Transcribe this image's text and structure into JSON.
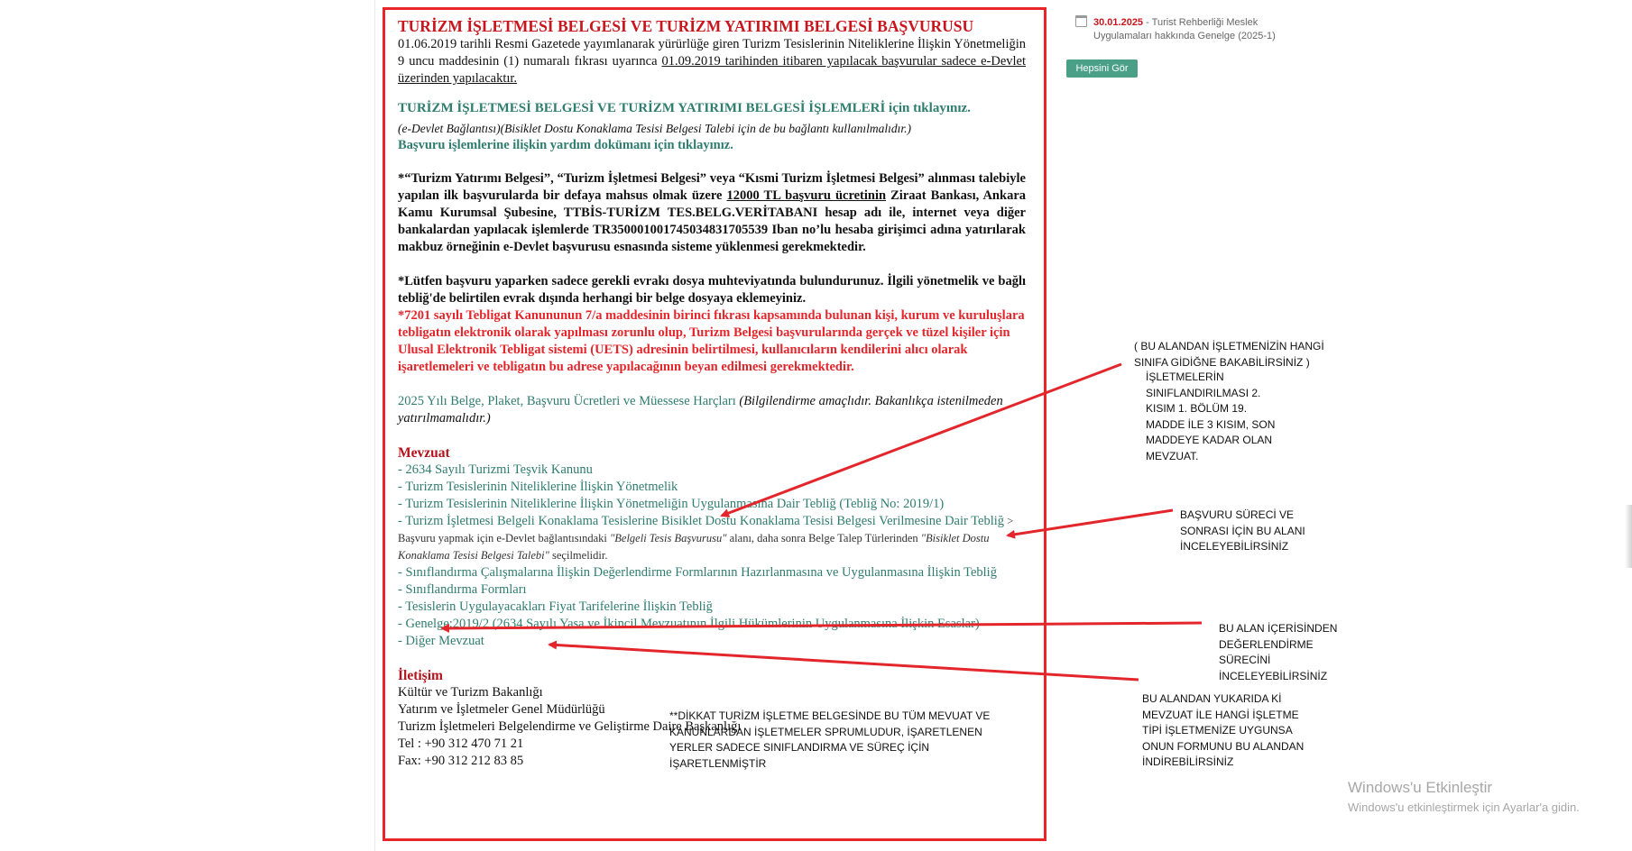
{
  "main": {
    "title": "TURİZM İŞLETMESİ BELGESİ VE TURİZM YATIRIMI BELGESİ BAŞVURUSU",
    "intro_a": "01.06.2019 tarihli Resmi Gazetede yayımlanarak yürürlüğe giren Turizm Tesislerinin Niteliklerine İlişkin Yönetmeliğin 9 uncu maddesinin (1) numaralı fıkrası uyarınca ",
    "intro_b": "01.09.2019 tarihinden itibaren yapılacak başvurular sadece e-Devlet üzerinden yapılacaktır.",
    "link_ops_text": "TURİZM İŞLETMESİ BELGESİ VE TURİZM YATIRIMI BELGESİ İŞLEMLERİ için tıklayınız.",
    "edevlet_note": "(e-Devlet Bağlantısı)(Bisiklet Dostu Konaklama Tesisi Belgesi Talebi için de bu bağlantı kullanılmalıdır.)",
    "help_link": "Başvuru işlemlerine ilişkin yardım dokümanı için tıklayınız.",
    "fee_a": "*“Turizm Yatırımı Belgesi”, “Turizm İşletmesi Belgesi” veya “Kısmi Turizm İşletmesi Belgesi” alınması talebiyle yapılan ilk başvurularda bir defaya mahsus olmak üzere ",
    "fee_b": "12000 TL başvuru ücretinin",
    "fee_c": " Ziraat Bankası, Ankara Kamu Kurumsal Şubesine, TTBİS-TURİZM TES.BELG.VERİTABANI hesap adı ile, internet veya diğer bankalardan yapılacak işlemlerde TR350001001745034831705539 Iban no’lu hesaba girişimci adına yatırılarak makbuz örneğinin e-Devlet başvurusu esnasında sisteme yüklenmesi gerekmektedir.",
    "docs_note": "*Lütfen başvuru yaparken sadece gerekli evrakı dosya muhteviyatında bulundurunuz. İlgili yönetmelik ve bağlı tebliğ'de belirtilen evrak dışında herhangi bir belge dosyaya eklemeyiniz.",
    "tebligat_note": "*7201 sayılı Tebligat Kanununun 7/a maddesinin birinci fıkrası kapsamında bulunan kişi, kurum ve kuruluşlara tebligatın elektronik olarak yapılması zorunlu olup, Turizm Belgesi başvurularında gerçek ve tüzel kişiler için Ulusal Elektronik Tebligat sistemi (UETS) adresinin belirtilmesi, kullanıcıların kendilerini alıcı olarak işaretlemeleri ve tebligatın bu adrese yapılacağının beyan edilmesi gerekmektedir.",
    "fees_link": "2025 Yılı Belge, Plaket, Başvuru Ücretleri ve Müessese Harçları",
    "fees_note": " (Bilgilendirme amaçlıdır. Bakanlıkça istenilmeden yatırılmamalıdır.)",
    "mevzuat_heading": "Mevzuat",
    "mevzuat": [
      "- 2634 Sayılı Turizmi Teşvik Kanunu",
      "- Turizm Tesislerinin Niteliklerine İlişkin Yönetmelik",
      "- Turizm Tesislerinin Niteliklerine İlişkin Yönetmeliğin Uygulanmasına Dair Tebliğ (Tebliğ No: 2019/1)",
      "- Turizm İşletmesi Belgeli Konaklama Tesislerine Bisiklet Dostu Konaklama Tesisi Belgesi Verilmesine Dair Tebliğ"
    ],
    "bisiklet_a": "  > Başvuru yapmak için e-Devlet bağlantısındaki ",
    "bisiklet_b": "\"Belgeli Tesis Başvurusu\"",
    "bisiklet_c": " alanı, daha sonra Belge Talep Türlerinden ",
    "bisiklet_d": "\"Bisiklet Dostu Konaklama Tesisi Belgesi Talebi\"",
    "bisiklet_e": " seçilmelidir.",
    "mevzuat2": [
      "- Sınıflandırma Çalışmalarına İlişkin Değerlendirme Formlarının Hazırlanmasına ve Uygulanmasına İlişkin Tebliğ",
      "- Sınıflandırma Formları",
      "- Tesislerin Uygulayacakları Fiyat Tarifelerine İlişkin Tebliğ",
      "- Genelge:2019/2 (2634 Sayılı Yasa ve İkincil Mevzuatının İlgili Hükümlerinin Uygulanmasına İlişkin Esaslar)",
      "- Diğer Mevzuat"
    ],
    "contact_heading": "İletişim",
    "contact": [
      "Kültür ve Turizm Bakanlığı",
      "Yatırım ve İşletmeler Genel Müdürlüğü",
      "Turizm İşletmeleri Belgelendirme ve Geliştirme Daire Başkanlığı",
      "Tel : +90 312 470 71 21",
      "Fax: +90 312 212 83 85"
    ]
  },
  "sidebar": {
    "news_date": "30.01.2025",
    "news_text": " - Turist Rehberliği Meslek Uygulamaları hakkında Genelge (2025-1)",
    "all_button": "Hepsini Gör",
    "calendar_icon": "calendar-icon"
  },
  "annotations": {
    "a1": "( BU ALANDAN İŞLETMENİZİN HANGİ SINIFA GİDİĞNE BAKABİLİRSİNİZ )",
    "a1b": "İŞLETMELERİN SINIFLANDIRILMASI 2. KISIM 1. BÖLÜM 19. MADDE İLE 3 KISIM, SON MADDEYE KADAR OLAN MEVZUAT.",
    "a2": "BAŞVURU SÜRECİ VE SONRASI İÇİN BU ALANI İNCELEYEBİLİRSİNİZ",
    "a3": "BU ALAN İÇERİSİNDEN DEĞERLENDİRME SÜRECİNİ İNCELEYEBİLİRSİNİZ",
    "a4": "BU ALANDAN YUKARIDA Kİ MEVZUAT İLE HANGİ İŞLETME TİPİ İŞLETMENİZE UYGUNSA ONUN FORMUNU BU ALANDAN İNDİREBİLİRSİNİZ",
    "note": "**DİKKAT TURİZM İŞLETME BELGESİNDE BU TÜM MEVUAT VE KANUNLARDAN İŞLETMELER SPRUMLUDUR, İŞARETLENEN YERLER SADECE SINIFLANDIRMA VE SÜREÇ İÇİN İŞARETLENMİŞTİR"
  },
  "watermark": {
    "title": "Windows'u Etkinleştir",
    "subtitle": "Windows'u etkinleştirmek için Ayarlar'a gidin."
  },
  "colors": {
    "highlight_box": "#e8262a",
    "title_red": "#c9151c",
    "link_teal": "#2f7d6e",
    "button": "#4aa087"
  }
}
